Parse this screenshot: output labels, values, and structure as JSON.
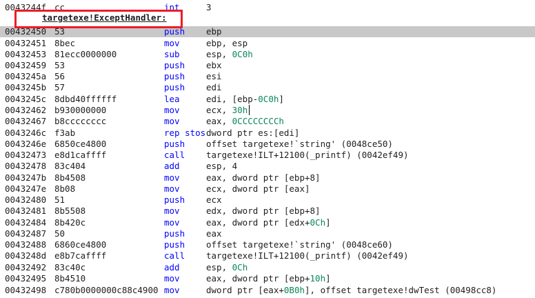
{
  "title_symbol": "targetexe!ExceptHandler:",
  "current_index": 1,
  "lines": [
    {
      "addr": "0043244f",
      "bytes": "cc",
      "mnem": "int",
      "ops": [
        {
          "t": "3"
        }
      ]
    },
    {
      "addr": "00432450",
      "bytes": "53",
      "mnem": "push",
      "ops": [
        {
          "t": "ebp"
        }
      ]
    },
    {
      "addr": "00432451",
      "bytes": "8bec",
      "mnem": "mov",
      "ops": [
        {
          "t": "ebp, esp"
        }
      ]
    },
    {
      "addr": "00432453",
      "bytes": "81ecc0000000",
      "mnem": "sub",
      "ops": [
        {
          "t": "esp, "
        },
        {
          "t": "0C0h",
          "hex": true
        }
      ]
    },
    {
      "addr": "00432459",
      "bytes": "53",
      "mnem": "push",
      "ops": [
        {
          "t": "ebx"
        }
      ]
    },
    {
      "addr": "0043245a",
      "bytes": "56",
      "mnem": "push",
      "ops": [
        {
          "t": "esi"
        }
      ]
    },
    {
      "addr": "0043245b",
      "bytes": "57",
      "mnem": "push",
      "ops": [
        {
          "t": "edi"
        }
      ]
    },
    {
      "addr": "0043245c",
      "bytes": "8dbd40ffffff",
      "mnem": "lea",
      "ops": [
        {
          "t": "edi, [ebp-"
        },
        {
          "t": "0C0h",
          "hex": true
        },
        {
          "t": "]"
        }
      ]
    },
    {
      "addr": "00432462",
      "bytes": "b930000000",
      "mnem": "mov",
      "ops": [
        {
          "t": "ecx, "
        },
        {
          "t": "30h",
          "hex": true
        }
      ]
    },
    {
      "addr": "00432467",
      "bytes": "b8cccccccc",
      "mnem": "mov",
      "ops": [
        {
          "t": "eax, "
        },
        {
          "t": "0CCCCCCCCh",
          "hex": true
        }
      ]
    },
    {
      "addr": "0043246c",
      "bytes": "f3ab",
      "mnem": "rep stos",
      "ops": [
        {
          "t": "dword ptr es:[edi]"
        }
      ]
    },
    {
      "addr": "0043246e",
      "bytes": "6850ce4800",
      "mnem": "push",
      "ops": [
        {
          "t": "offset targetexe!`string' (0048ce50)"
        }
      ]
    },
    {
      "addr": "00432473",
      "bytes": "e8d1caffff",
      "mnem": "call",
      "ops": [
        {
          "t": "targetexe!ILT+12100(_printf) (0042ef49)"
        }
      ]
    },
    {
      "addr": "00432478",
      "bytes": "83c404",
      "mnem": "add",
      "ops": [
        {
          "t": "esp, 4"
        }
      ]
    },
    {
      "addr": "0043247b",
      "bytes": "8b4508",
      "mnem": "mov",
      "ops": [
        {
          "t": "eax, dword ptr [ebp+8]"
        }
      ]
    },
    {
      "addr": "0043247e",
      "bytes": "8b08",
      "mnem": "mov",
      "ops": [
        {
          "t": "ecx, dword ptr [eax]"
        }
      ]
    },
    {
      "addr": "00432480",
      "bytes": "51",
      "mnem": "push",
      "ops": [
        {
          "t": "ecx"
        }
      ]
    },
    {
      "addr": "00432481",
      "bytes": "8b5508",
      "mnem": "mov",
      "ops": [
        {
          "t": "edx, dword ptr [ebp+8]"
        }
      ]
    },
    {
      "addr": "00432484",
      "bytes": "8b420c",
      "mnem": "mov",
      "ops": [
        {
          "t": "eax, dword ptr [edx+"
        },
        {
          "t": "0Ch",
          "hex": true
        },
        {
          "t": "]"
        }
      ]
    },
    {
      "addr": "00432487",
      "bytes": "50",
      "mnem": "push",
      "ops": [
        {
          "t": "eax"
        }
      ]
    },
    {
      "addr": "00432488",
      "bytes": "6860ce4800",
      "mnem": "push",
      "ops": [
        {
          "t": "offset targetexe!`string' (0048ce60)"
        }
      ]
    },
    {
      "addr": "0043248d",
      "bytes": "e8b7caffff",
      "mnem": "call",
      "ops": [
        {
          "t": "targetexe!ILT+12100(_printf) (0042ef49)"
        }
      ]
    },
    {
      "addr": "00432492",
      "bytes": "83c40c",
      "mnem": "add",
      "ops": [
        {
          "t": "esp, "
        },
        {
          "t": "0Ch",
          "hex": true
        }
      ]
    },
    {
      "addr": "00432495",
      "bytes": "8b4510",
      "mnem": "mov",
      "ops": [
        {
          "t": "eax, dword ptr [ebp+"
        },
        {
          "t": "10h",
          "hex": true
        },
        {
          "t": "]"
        }
      ]
    },
    {
      "addr": "00432498",
      "bytes": "c780b0000000c88c4900",
      "mnem": "mov",
      "ops": [
        {
          "t": "dword ptr [eax+"
        },
        {
          "t": "0B0h",
          "hex": true
        },
        {
          "t": "], offset targetexe!dwTest (00498cc8)"
        }
      ]
    }
  ]
}
